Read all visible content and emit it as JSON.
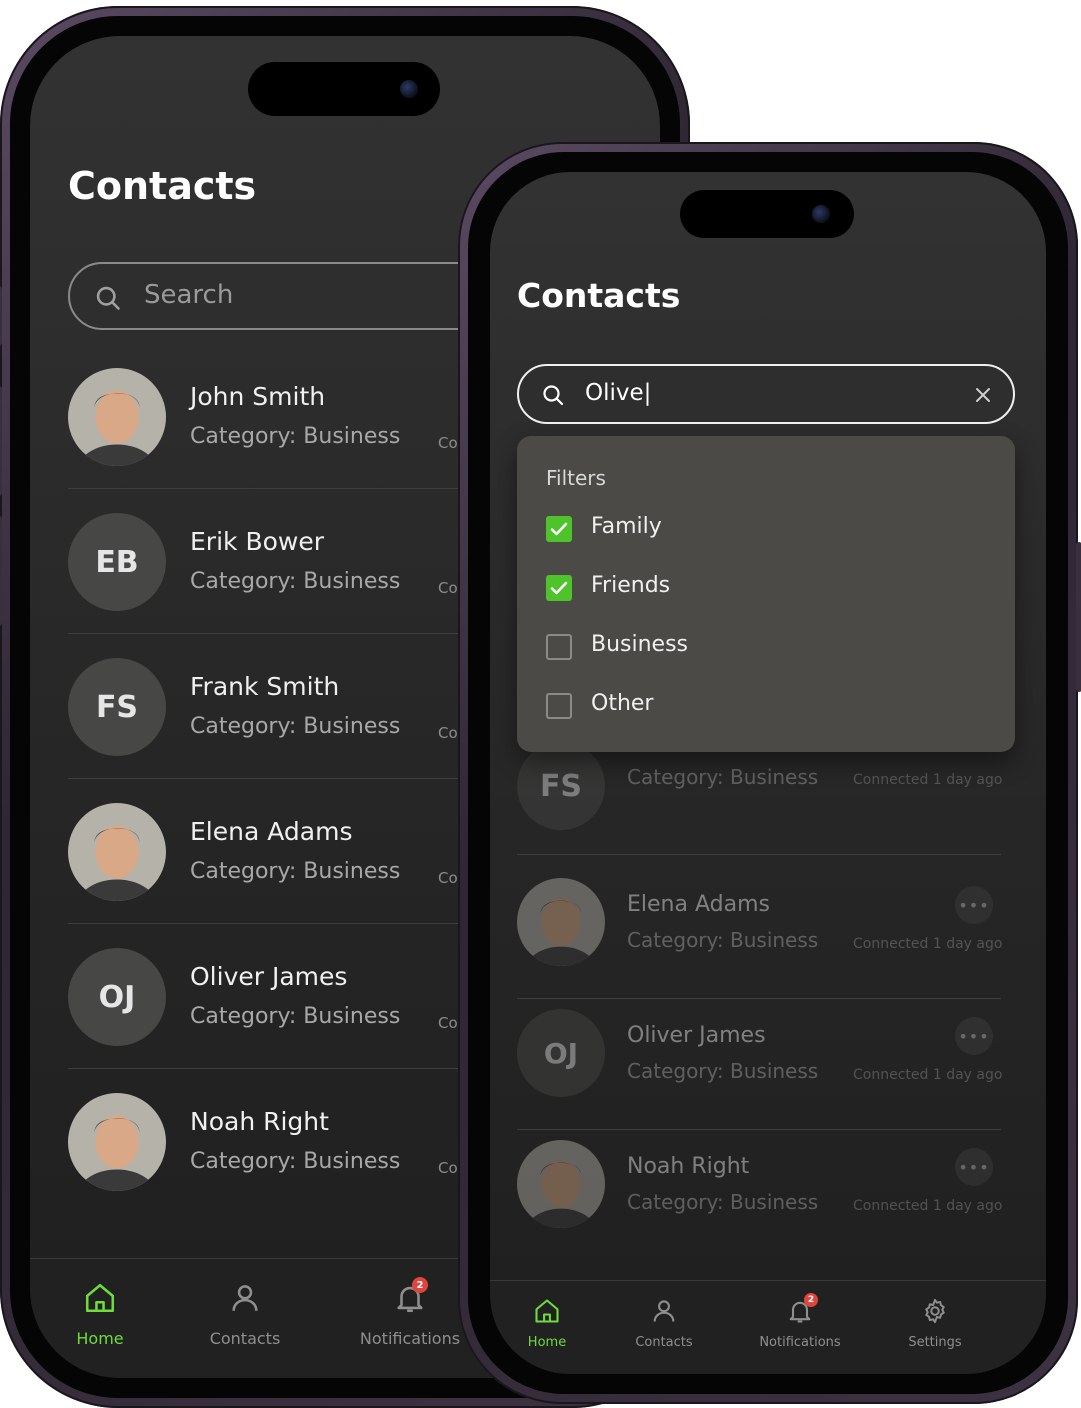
{
  "back_phone": {
    "title": "Contacts",
    "search_placeholder": "Search",
    "contacts": [
      {
        "name": "John Smith",
        "category": "Category: Business",
        "connected": "Co",
        "initials": "",
        "avatar": "photo"
      },
      {
        "name": "Erik Bower",
        "category": "Category: Business",
        "connected": "Co",
        "initials": "EB",
        "avatar": "initials"
      },
      {
        "name": "Frank Smith",
        "category": "Category: Business",
        "connected": "Co",
        "initials": "FS",
        "avatar": "initials"
      },
      {
        "name": "Elena Adams",
        "category": "Category: Business",
        "connected": "Co",
        "initials": "",
        "avatar": "photo"
      },
      {
        "name": "Oliver James",
        "category": "Category: Business",
        "connected": "Co",
        "initials": "OJ",
        "avatar": "initials"
      },
      {
        "name": "Noah Right",
        "category": "Category: Business",
        "connected": "Co",
        "initials": "",
        "avatar": "photo"
      }
    ],
    "nav": [
      {
        "label": "Home",
        "icon": "home-icon",
        "active": true
      },
      {
        "label": "Contacts",
        "icon": "user-icon",
        "active": false
      },
      {
        "label": "Notifications",
        "icon": "bell-icon",
        "active": false,
        "badge": "2"
      }
    ]
  },
  "front_phone": {
    "title": "Contacts",
    "search_value": "Olive|",
    "filters": {
      "heading": "Filters",
      "items": [
        {
          "label": "Family",
          "checked": true
        },
        {
          "label": "Friends",
          "checked": true
        },
        {
          "label": "Business",
          "checked": false
        },
        {
          "label": "Other",
          "checked": false
        }
      ]
    },
    "partial_row": {
      "initials": "FS",
      "category": "Category: Business",
      "connected": "Connected 1 day ago"
    },
    "contacts": [
      {
        "name": "Elena Adams",
        "category": "Category: Business",
        "connected": "Connected 1 day ago",
        "initials": "",
        "avatar": "photo"
      },
      {
        "name": "Oliver James",
        "category": "Category: Business",
        "connected": "Connected 1 day ago",
        "initials": "OJ",
        "avatar": "initials"
      },
      {
        "name": "Noah Right",
        "category": "Category: Business",
        "connected": "Connected 1 day ago",
        "initials": "",
        "avatar": "photo"
      }
    ],
    "nav": [
      {
        "label": "Home",
        "icon": "home-icon",
        "active": true
      },
      {
        "label": "Contacts",
        "icon": "user-icon",
        "active": false
      },
      {
        "label": "Notifications",
        "icon": "bell-icon",
        "active": false,
        "badge": "2"
      },
      {
        "label": "Settings",
        "icon": "gear-icon",
        "active": false
      }
    ]
  },
  "colors": {
    "accent": "#6ddc3c",
    "checkbox": "#4ec32a",
    "badge": "#e0443c",
    "screen": "#2b2b2b",
    "dropdown": "#4b4a47"
  }
}
